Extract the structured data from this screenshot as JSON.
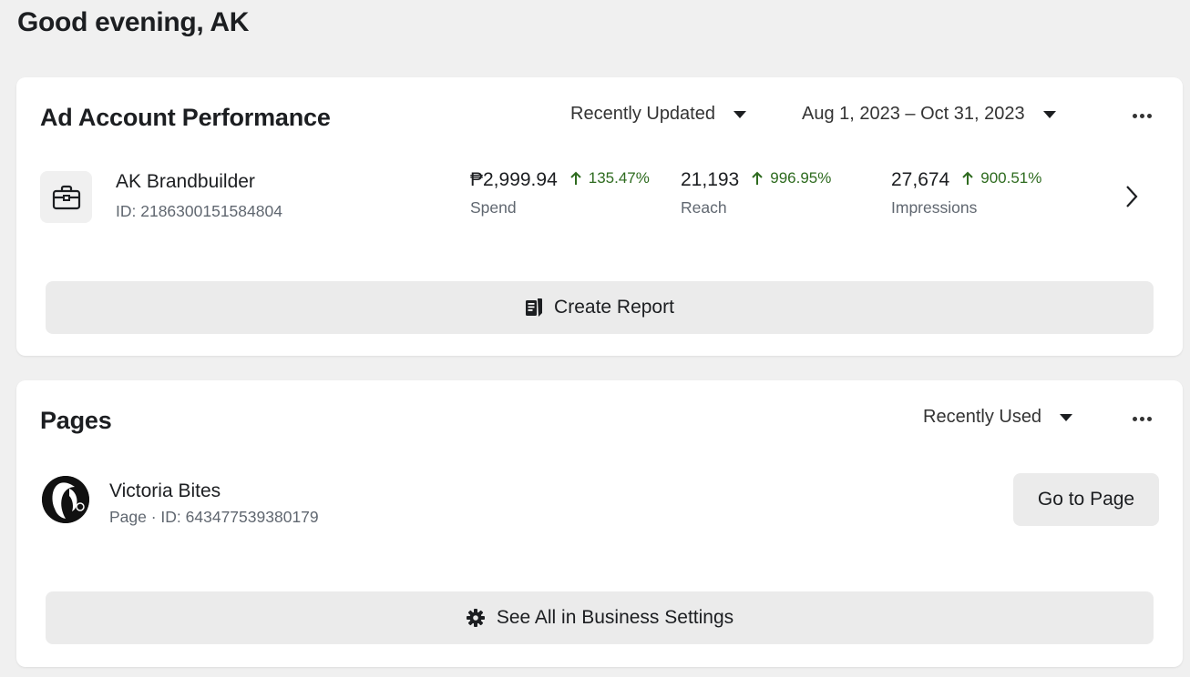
{
  "greeting": "Good evening, AK",
  "ad_performance": {
    "title": "Ad Account Performance",
    "sort_dropdown": "Recently Updated",
    "date_range": "Aug 1, 2023 – Oct 31, 2023",
    "more_icon": "more-horizontal-icon",
    "account": {
      "icon": "briefcase-icon",
      "name": "AK Brandbuilder",
      "id_text": "ID: 2186300151584804",
      "metrics": [
        {
          "value": "₱2,999.94",
          "change": "135.47%",
          "label": "Spend"
        },
        {
          "value": "21,193",
          "change": "996.95%",
          "label": "Reach"
        },
        {
          "value": "27,674",
          "change": "900.51%",
          "label": "Impressions"
        }
      ]
    },
    "create_report_label": "Create Report",
    "colors": {
      "positive_change": "#2e6b1f"
    }
  },
  "pages": {
    "title": "Pages",
    "sort_dropdown": "Recently Used",
    "more_icon": "more-horizontal-icon",
    "page": {
      "name": "Victoria Bites",
      "sub_text": "Page · ID: 643477539380179",
      "button_label": "Go to Page"
    },
    "settings_label": "See All in Business Settings"
  }
}
